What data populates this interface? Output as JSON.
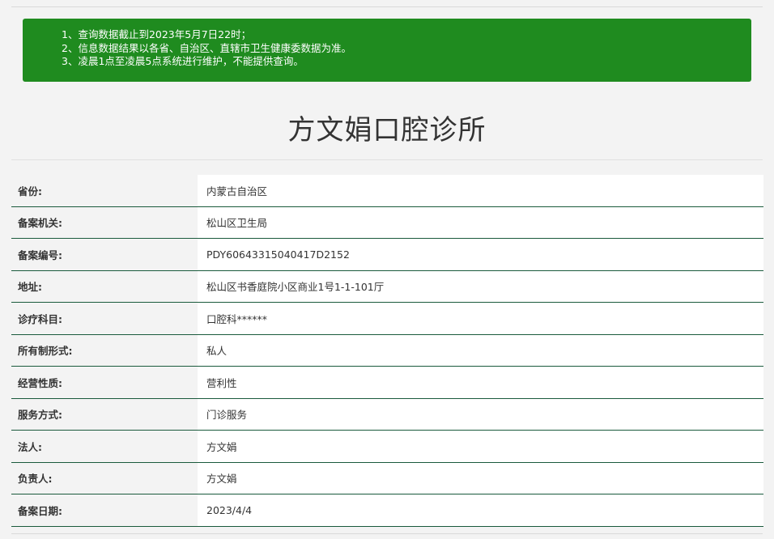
{
  "notice": {
    "lines": [
      "1、查询数据截止到2023年5月7日22时；",
      "2、信息数据结果以各省、自治区、直辖市卫生健康委数据为准。",
      "3、凌晨1点至凌晨5点系统进行维护，不能提供查询。"
    ],
    "background_color": "#1f8b1f"
  },
  "page_title": "方文娟口腔诊所",
  "table": {
    "border_color": "#1a5a3c",
    "rows": [
      {
        "label": "省份:",
        "value": "内蒙古自治区"
      },
      {
        "label": "备案机关:",
        "value": "松山区卫生局"
      },
      {
        "label": "备案编号:",
        "value": "PDY60643315040417D2152"
      },
      {
        "label": "地址:",
        "value": "松山区书香庭院小区商业1号1-1-101厅"
      },
      {
        "label": "诊疗科目:",
        "value": "口腔科******"
      },
      {
        "label": "所有制形式:",
        "value": "私人"
      },
      {
        "label": "经营性质:",
        "value": "营利性"
      },
      {
        "label": "服务方式:",
        "value": "门诊服务"
      },
      {
        "label": "法人:",
        "value": "方文娟"
      },
      {
        "label": "负责人:",
        "value": "方文娟"
      },
      {
        "label": "备案日期:",
        "value": "2023/4/4"
      }
    ]
  }
}
